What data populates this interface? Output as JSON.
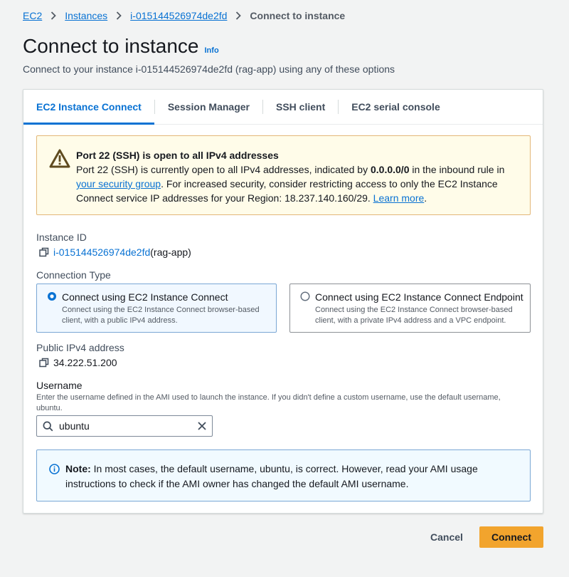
{
  "breadcrumb": {
    "items": [
      "EC2",
      "Instances",
      "i-015144526974de2fd"
    ],
    "current": "Connect to instance"
  },
  "header": {
    "title": "Connect to instance",
    "info": "Info",
    "description": "Connect to your instance i-015144526974de2fd (rag-app) using any of these options"
  },
  "tabs": [
    {
      "label": "EC2 Instance Connect",
      "active": true
    },
    {
      "label": "Session Manager"
    },
    {
      "label": "SSH client"
    },
    {
      "label": "EC2 serial console"
    }
  ],
  "warning": {
    "title": "Port 22 (SSH) is open to all IPv4 addresses",
    "text_1": "Port 22 (SSH) is currently open to all IPv4 addresses, indicated by ",
    "cidr": "0.0.0.0/0",
    "text_2": " in the inbound rule in ",
    "link_sg": "your security group",
    "text_3": ". For increased security, consider restricting access to only the EC2 Instance Connect service IP addresses for your Region: 18.237.140.160/29. ",
    "link_learn": "Learn more",
    "text_4": "."
  },
  "instance": {
    "label": "Instance ID",
    "id": "i-015144526974de2fd",
    "name": " (rag-app)"
  },
  "connection_type": {
    "label": "Connection Type",
    "options": [
      {
        "title": "Connect using EC2 Instance Connect",
        "desc": "Connect using the EC2 Instance Connect browser-based client, with a public IPv4 address.",
        "selected": true
      },
      {
        "title": "Connect using EC2 Instance Connect Endpoint",
        "desc": "Connect using the EC2 Instance Connect browser-based client, with a private IPv4 address and a VPC endpoint.",
        "selected": false
      }
    ]
  },
  "public_ip": {
    "label": "Public IPv4 address",
    "value": "34.222.51.200"
  },
  "username": {
    "label": "Username",
    "hint": "Enter the username defined in the AMI used to launch the instance. If you didn't define a custom username, use the default username, ubuntu.",
    "value": "ubuntu"
  },
  "note": {
    "bold": "Note:",
    "text": " In most cases, the default username, ubuntu, is correct. However, read your AMI usage instructions to check if the AMI owner has changed the default AMI username."
  },
  "actions": {
    "cancel": "Cancel",
    "connect": "Connect"
  },
  "colors": {
    "accent": "#0972d3",
    "primary_button": "#f2a42d",
    "warning_bg": "#fffce9",
    "info_bg": "#f1faff"
  }
}
